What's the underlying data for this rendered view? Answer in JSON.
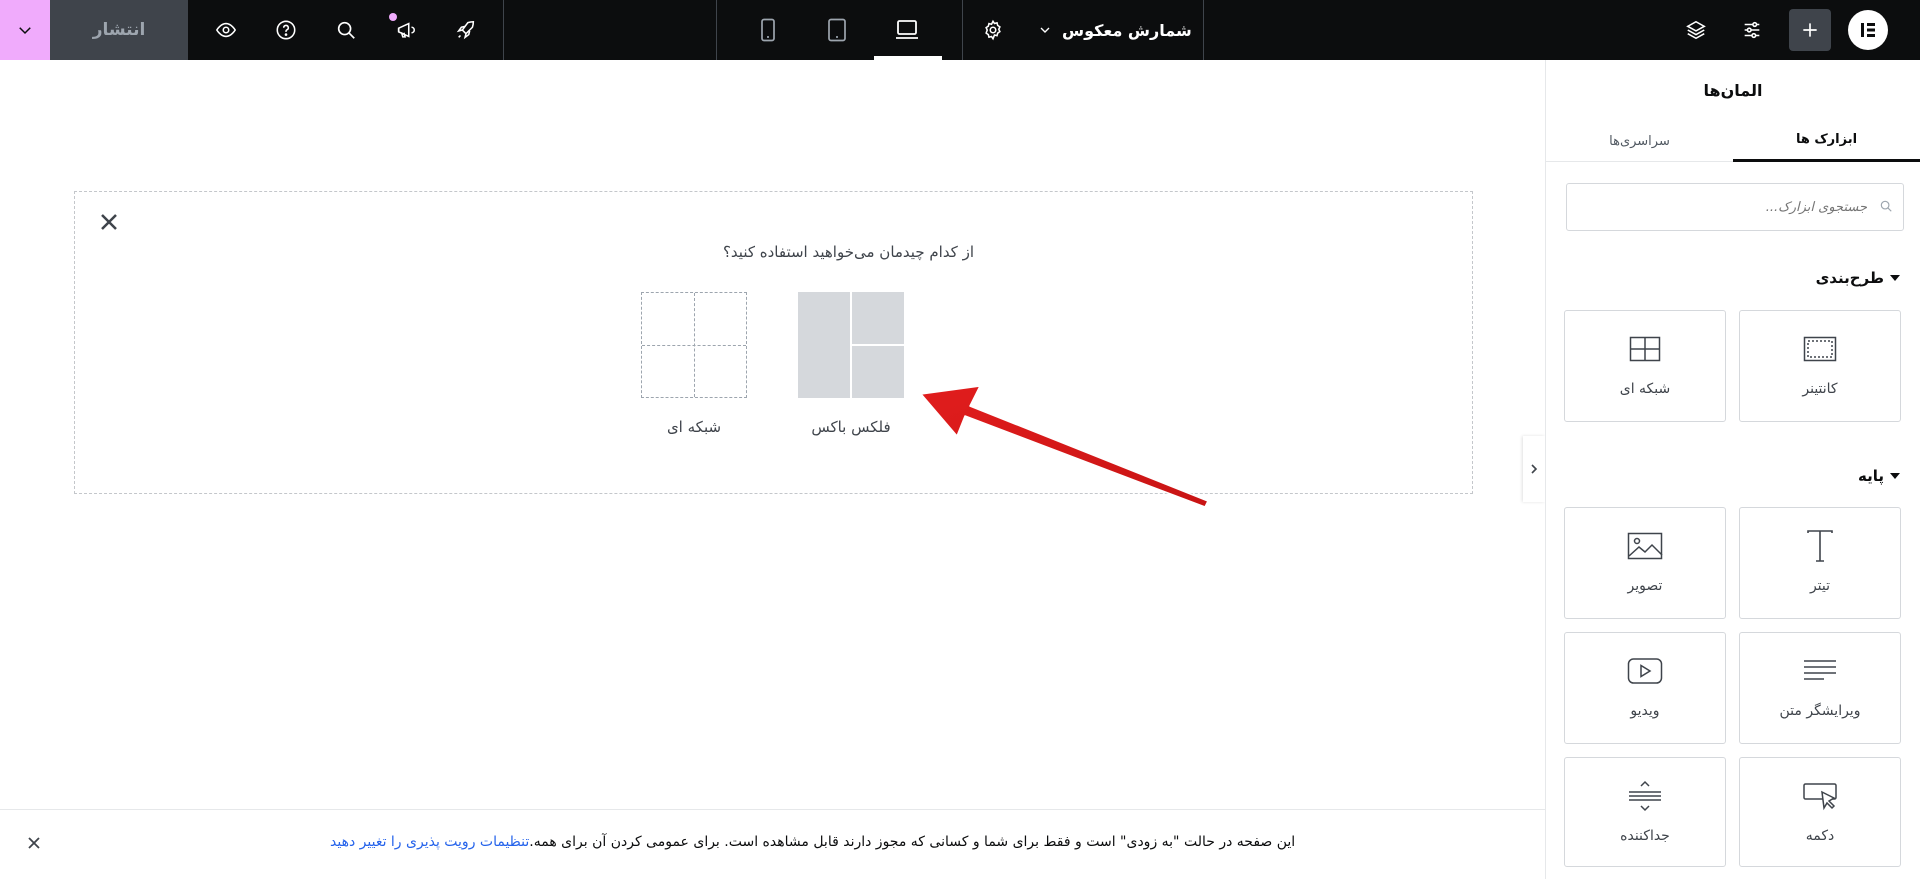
{
  "topbar": {
    "publish_label": "انتشار",
    "page_title": "شمارش معکوس"
  },
  "canvas": {
    "question": "از کدام چیدمان می‌خواهید استفاده کنید؟",
    "flexbox_label": "فلکس باکس",
    "grid_label": "شبکه ای"
  },
  "notice": {
    "text": "این صفحه در حالت \"به زودی\" است و فقط برای شما و کسانی که مجوز دارند قابل مشاهده است. برای عمومی کردن آن برای همه.",
    "link": "تنظیمات رویت پذیری را تغییر دهید"
  },
  "panel": {
    "title": "المان‌ها",
    "tabs": [
      "ابزارک ها",
      "سراسری‌ها"
    ],
    "search_placeholder": "جستجوی ابزارک...",
    "layout_section": "طرح‌بندی",
    "basic_section": "پایه",
    "layout_widgets": [
      "کانتینر",
      "شبکه ای"
    ],
    "basic_widgets": [
      "تیتر",
      "تصویر",
      "ویرایشگر متن",
      "ویدیو",
      "دکمه",
      "جداکننده"
    ]
  },
  "colors": {
    "topbar_bg": "#0c0d0e",
    "accent_pink": "#f0abfc",
    "arrow_red": "#e11d1d",
    "link_blue": "#2563eb"
  }
}
